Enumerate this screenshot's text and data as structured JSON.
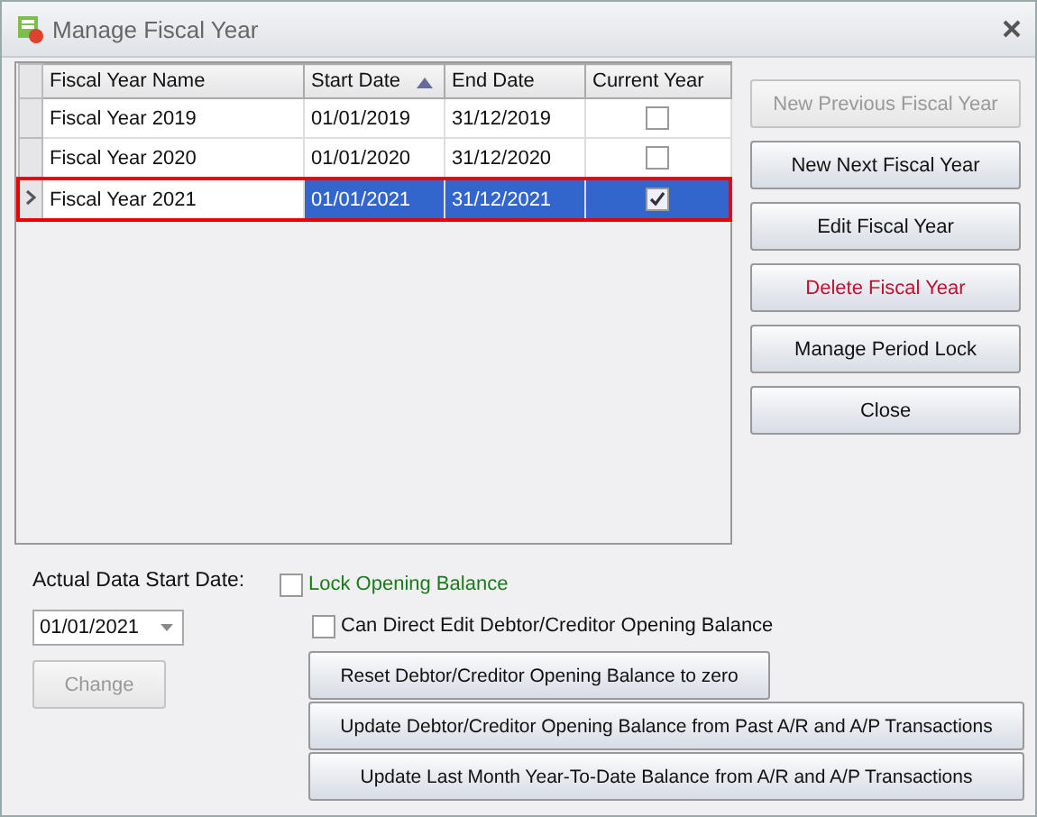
{
  "window": {
    "title": "Manage Fiscal Year"
  },
  "table": {
    "columns": [
      {
        "label": "Fiscal Year Name",
        "sorted_ascending": false
      },
      {
        "label": "Start Date",
        "sorted_ascending": true
      },
      {
        "label": "End Date",
        "sorted_ascending": false
      },
      {
        "label": "Current Year",
        "sorted_ascending": false
      }
    ],
    "rows": [
      {
        "name": "Fiscal Year 2019",
        "start": "01/01/2019",
        "end": "31/12/2019",
        "current": false,
        "selected": false
      },
      {
        "name": "Fiscal Year 2020",
        "start": "01/01/2020",
        "end": "31/12/2020",
        "current": false,
        "selected": false
      },
      {
        "name": "Fiscal Year 2021",
        "start": "01/01/2021",
        "end": "31/12/2021",
        "current": true,
        "selected": true
      }
    ]
  },
  "side_buttons": [
    {
      "label": "New Previous Fiscal Year",
      "kind": "normal",
      "disabled": true
    },
    {
      "label": "New Next Fiscal Year",
      "kind": "normal",
      "disabled": false
    },
    {
      "label": "Edit Fiscal Year",
      "kind": "normal",
      "disabled": false
    },
    {
      "label": "Delete Fiscal Year",
      "kind": "danger",
      "disabled": false
    },
    {
      "label": "Manage Period Lock",
      "kind": "normal",
      "disabled": false
    },
    {
      "label": "Close",
      "kind": "normal",
      "disabled": false
    }
  ],
  "start_date": {
    "label": "Actual Data Start Date:",
    "value": "01/01/2021",
    "change_button": {
      "label": "Change",
      "disabled": true
    }
  },
  "lock_opening_balance": {
    "label": "Lock Opening Balance",
    "checked": false
  },
  "direct_edit": {
    "label": "Can Direct Edit Debtor/Creditor Opening Balance",
    "checked": false
  },
  "action_buttons": [
    "Reset Debtor/Creditor Opening Balance to zero",
    "Update Debtor/Creditor Opening Balance from Past A/R and A/P Transactions",
    "Update Last Month Year-To-Date Balance from A/R and A/P Transactions"
  ]
}
